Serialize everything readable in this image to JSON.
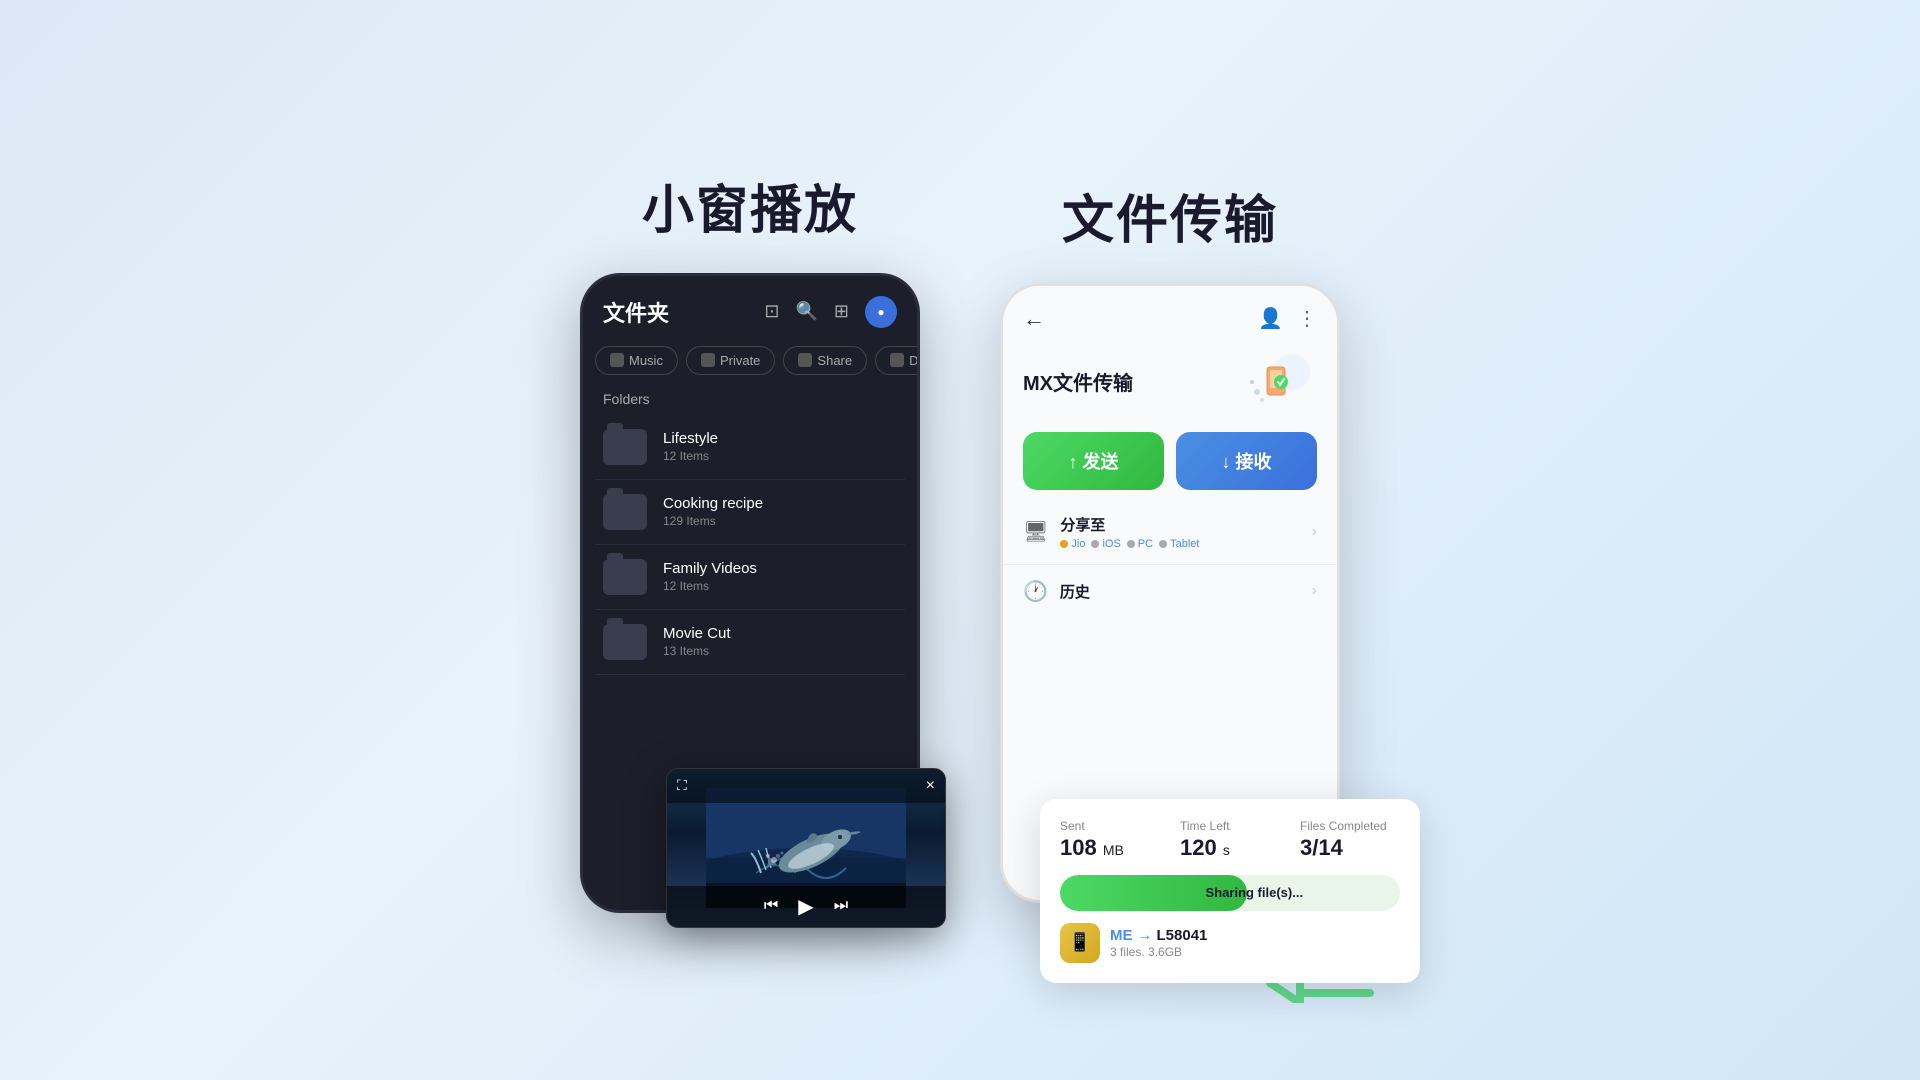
{
  "left": {
    "title": "小窗播放",
    "phone": {
      "header_title": "文件夹",
      "tabs": [
        {
          "label": "Music",
          "icon": "music"
        },
        {
          "label": "Private",
          "icon": "lock"
        },
        {
          "label": "Share",
          "icon": "share"
        },
        {
          "label": "Downloads",
          "icon": "download"
        }
      ],
      "folders_label": "Folders",
      "folders": [
        {
          "name": "Lifestyle",
          "count": "12 Items"
        },
        {
          "name": "Cooking recipe",
          "count": "129 Items"
        },
        {
          "name": "Family Videos",
          "count": "12 Items"
        },
        {
          "name": "Movie Cut",
          "count": "13 Items"
        }
      ]
    },
    "mini_player": {
      "expand_icon": "⛶",
      "close_icon": "×",
      "prev_icon": "⏮",
      "play_icon": "▶",
      "next_icon": "⏭"
    }
  },
  "right": {
    "title": "文件传输",
    "phone": {
      "mx_title": "MX文件传输",
      "send_label": "↑ 发送",
      "receive_label": "↓ 接收",
      "share_section_title": "分享至",
      "platforms": [
        "Jio",
        "iOS",
        "PC",
        "Tablet"
      ],
      "history_label": "历史"
    },
    "transfer_card": {
      "sent_label": "Sent",
      "sent_value": "108",
      "sent_unit": "MB",
      "time_label": "Time Left",
      "time_value": "120",
      "time_unit": "s",
      "files_label": "Files Completed",
      "files_value": "3/14",
      "progress_label": "Sharing file(s)...",
      "from": "ME",
      "arrow": "→",
      "to": "L58041",
      "files_info": "3 files. 3.6GB"
    }
  }
}
